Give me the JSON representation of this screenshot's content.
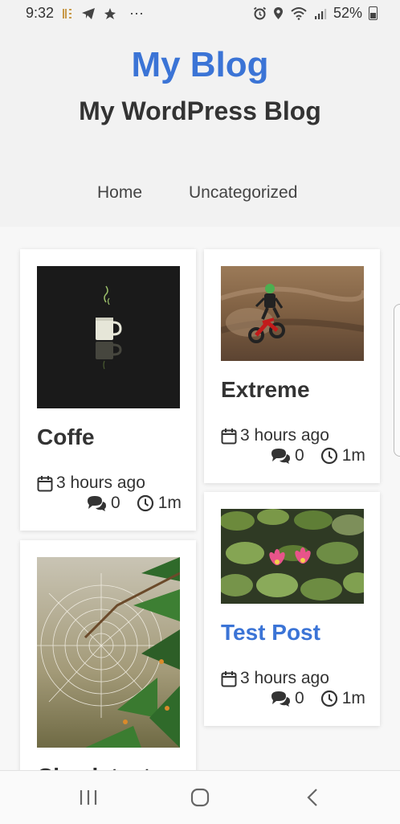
{
  "status_bar": {
    "time": "9:32",
    "dots": "···",
    "battery_percent": "52%",
    "icons": [
      "app-notification-icon",
      "telegram-icon",
      "alert-icon",
      "alarm-icon",
      "location-icon",
      "wifi-icon",
      "signal-icon",
      "battery-icon"
    ]
  },
  "site": {
    "title": "My Blog",
    "description": "My WordPress Blog"
  },
  "nav": {
    "items": [
      {
        "label": "Home"
      },
      {
        "label": "Uncategorized"
      }
    ]
  },
  "posts": [
    {
      "title": "Coffe",
      "date": "3 hours ago",
      "comments": "0",
      "read_time": "1m",
      "image": "coffee-mug-image"
    },
    {
      "title": "Extreme",
      "date": "3 hours ago",
      "comments": "0",
      "read_time": "1m",
      "image": "motocross-image"
    },
    {
      "title": "Test Post",
      "date": "3 hours ago",
      "comments": "0",
      "read_time": "1m",
      "image": "water-lilies-image",
      "title_color": "#3b74d6"
    },
    {
      "title": "Check text",
      "date": "",
      "comments": "",
      "read_time": "",
      "image": "spider-web-image"
    }
  ],
  "colors": {
    "accent": "#3b74d6",
    "header_bg": "#f2f2f2",
    "page_bg": "#f7f7f7"
  },
  "bottom_nav": {
    "icons": [
      "recent-apps-icon",
      "home-icon",
      "back-icon"
    ]
  }
}
